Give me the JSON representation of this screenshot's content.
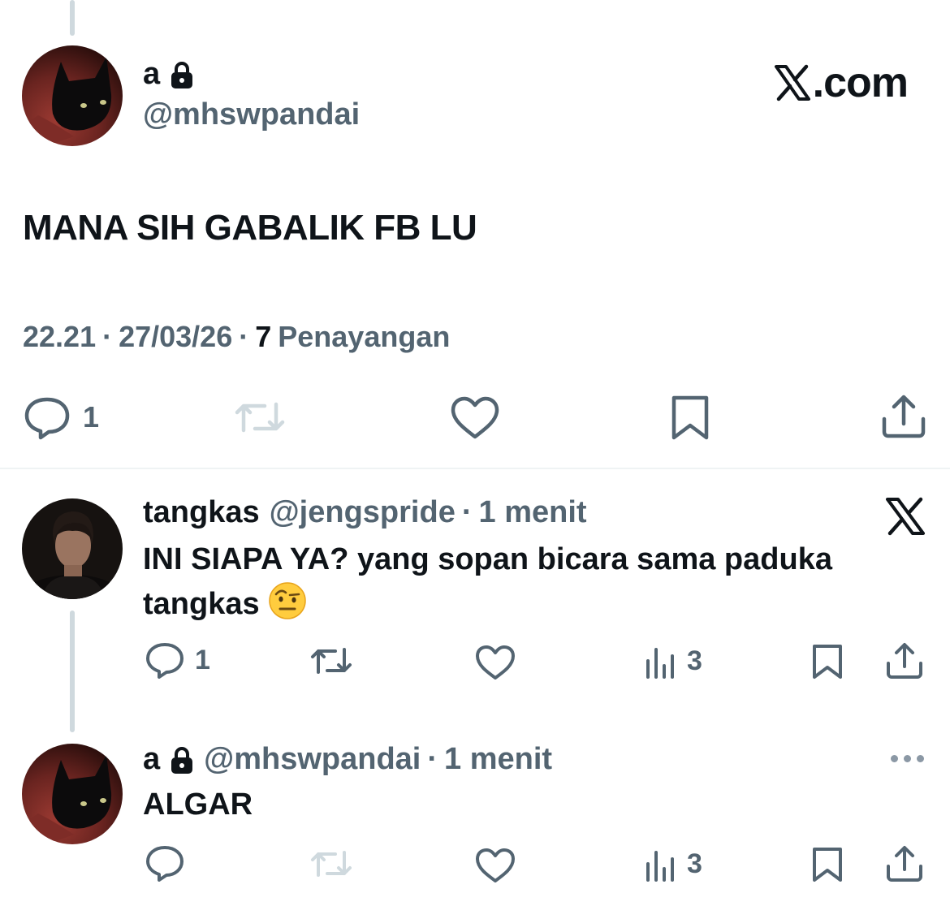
{
  "main_tweet": {
    "name": "a",
    "handle": "@mhswpandai",
    "brand": "X.com",
    "text": "MANA SIH GABALIK FB LU",
    "time": "22.21",
    "date": "27/03/26",
    "views_count": "7",
    "views_label": "Penayangan",
    "separator": "·",
    "reply_count": "1",
    "icons": {
      "reply": "reply-icon",
      "retweet": "retweet-icon",
      "like": "heart-icon",
      "bookmark": "bookmark-icon",
      "share": "share-icon",
      "lock": "lock-icon"
    }
  },
  "replies": [
    {
      "name": "tangkas",
      "handle": "@jengspride",
      "separator": "·",
      "time": "1 menit",
      "text": "INI SIAPA YA? yang sopan bicara sama paduka tangkas",
      "emoji": "raised-eyebrow-emoji",
      "reply_count": "1",
      "views_count": "3",
      "source_icon": "x-logo-icon"
    },
    {
      "name": "a",
      "handle": "@mhswpandai",
      "separator": "·",
      "time": "1 menit",
      "text": "ALGAR",
      "views_count": "3",
      "menu_icon": "more-icon"
    }
  ],
  "colors": {
    "text_primary": "#0f1419",
    "text_secondary": "#536471",
    "icon_disabled": "#cfd9de",
    "thread_line": "#cfd9de",
    "divider": "#eff3f4"
  }
}
